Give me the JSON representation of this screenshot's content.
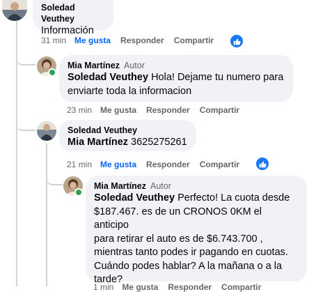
{
  "colors": {
    "bubble_bg": "#f0f2f5",
    "like_blue": "#0866ff",
    "meta_gray": "#65676b",
    "thread_line": "#d0d3d8",
    "online_green": "#31a24c"
  },
  "comments": [
    {
      "author": "Soledad Veuthey",
      "text": "Información",
      "time": "31 min",
      "like_label": "Me gusta",
      "reply_label": "Responder",
      "share_label": "Compartir",
      "liked": true,
      "reaction_icon": "thumbs-up-icon"
    },
    {
      "author": "Mia Martínez",
      "author_badge": "Autor",
      "mention": "Soledad Veuthey",
      "text_line1": "Hola! Dejame tu numero para",
      "text_line2": "enviarte toda la informacion",
      "time": "23 min",
      "like_label": "Me gusta",
      "reply_label": "Responder",
      "share_label": "Compartir",
      "liked": false
    },
    {
      "author": "Soledad Veuthey",
      "mention": "Mia Martínez",
      "text": "3625275261",
      "time": "21 min",
      "like_label": "Me gusta",
      "reply_label": "Responder",
      "share_label": "Compartir",
      "liked": true,
      "reaction_icon": "thumbs-up-icon"
    },
    {
      "author": "Mia Martínez",
      "author_badge": "Autor",
      "mention": "Soledad Veuthey",
      "lines": [
        "Perfecto! La cuota desde",
        "$187.467. es de un CRONOS 0KM el anticipo",
        "para retirar el auto es de $6.743.700 ,",
        "mientras tanto podes ir pagando en cuotas.",
        "Cuándo podes hablar? A la mañana o a la",
        "tarde?"
      ],
      "time": "1 min",
      "like_label": "Me gusta",
      "reply_label": "Responder",
      "share_label": "Compartir"
    }
  ]
}
